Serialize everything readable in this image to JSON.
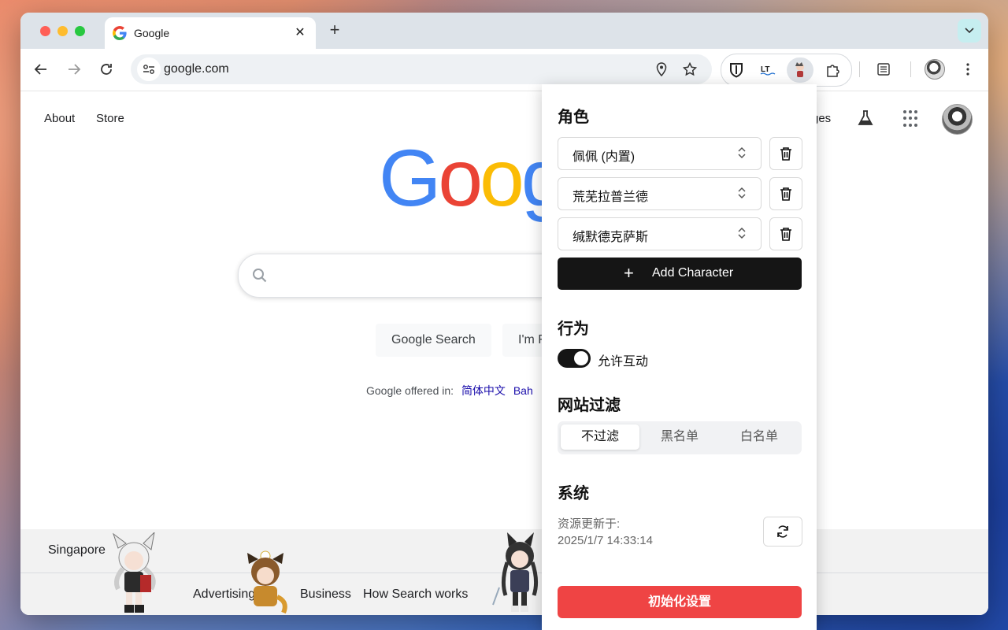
{
  "browser": {
    "tab": {
      "title": "Google",
      "close": "✕"
    },
    "new_tab": "+",
    "omnibox": {
      "url": "google.com"
    }
  },
  "google": {
    "top_links": [
      "About",
      "Store"
    ],
    "top_right_partial": "ges",
    "logo_letters": [
      {
        "char": "G",
        "color": "#4285F4"
      },
      {
        "char": "o",
        "color": "#EA4335"
      },
      {
        "char": "o",
        "color": "#FBBC05"
      },
      {
        "char": "g",
        "color": "#4285F4"
      }
    ],
    "buttons": {
      "search": "Google Search",
      "lucky": "I'm F"
    },
    "offered_label": "Google offered in:",
    "languages": [
      "简体中文",
      "Bah"
    ],
    "footer": {
      "country": "Singapore",
      "links": [
        "Advertising",
        "Business",
        "How Search works"
      ]
    }
  },
  "popup": {
    "characters_heading": "角色",
    "characters": [
      {
        "name": "佩佩 (内置)"
      },
      {
        "name": "荒芜拉普兰德"
      },
      {
        "name": "缄默德克萨斯"
      }
    ],
    "add_character_label": "Add Character",
    "add_character_plus": "+",
    "behavior_heading": "行为",
    "allow_interaction_label": "允许互动",
    "allow_interaction_on": true,
    "site_filter_heading": "网站过滤",
    "site_filter_options": [
      "不过滤",
      "黑名单",
      "白名单"
    ],
    "site_filter_selected": "不过滤",
    "system_heading": "系统",
    "resource_updated_label": "资源更新于:",
    "resource_updated_time": "2025/1/7 14:33:14",
    "reset_label": "初始化设置",
    "bottom_partial": "---"
  }
}
